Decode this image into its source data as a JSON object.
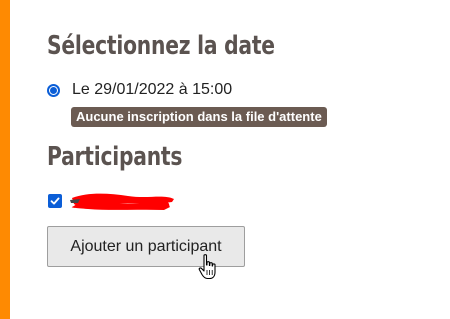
{
  "section_date": {
    "title": "Sélectionnez la date",
    "option_label": "Le 29/01/2022 à 15:00",
    "option_selected": true,
    "badge_text": "Aucune inscription dans la file d'attente"
  },
  "section_participants": {
    "title": "Participants",
    "participant_checked": true,
    "add_button_label": "Ajouter un participant"
  },
  "colors": {
    "accent_bar": "#fe8a02",
    "heading": "#5b5350",
    "badge_bg": "#6b5b52",
    "control_blue": "#0b5ed7",
    "redaction_red": "#ff0000"
  },
  "icons": {
    "cursor": "hand-pointer-icon",
    "checkbox": "checkmark-icon"
  }
}
